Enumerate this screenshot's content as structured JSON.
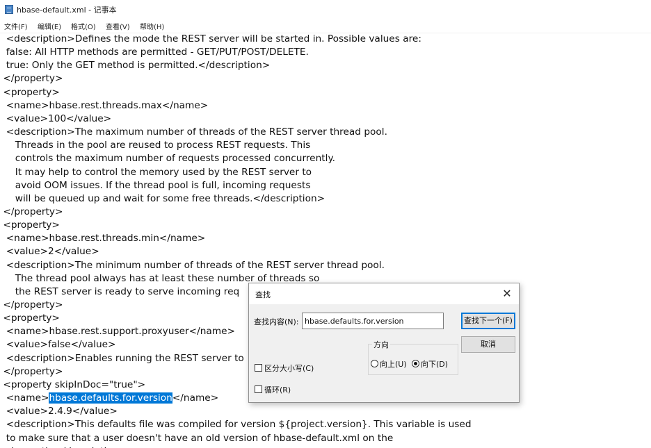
{
  "window": {
    "title": "hbase-default.xml - 记事本",
    "icon": "notepad-icon"
  },
  "menu": [
    {
      "label": "文件(F)"
    },
    {
      "label": "编辑(E)"
    },
    {
      "label": "格式(O)"
    },
    {
      "label": "查看(V)"
    },
    {
      "label": "帮助(H)"
    }
  ],
  "editor": {
    "lines": [
      "  <description>Defines the mode the REST server will be started in. Possible values are:",
      "  false: All HTTP methods are permitted - GET/PUT/POST/DELETE.",
      "  true: Only the GET method is permitted.</description>",
      " </property>",
      " <property>",
      "  <name>hbase.rest.threads.max</name>",
      "  <value>100</value>",
      "  <description>The maximum number of threads of the REST server thread pool.",
      "     Threads in the pool are reused to process REST requests. This",
      "     controls the maximum number of requests processed concurrently.",
      "     It may help to control the memory used by the REST server to",
      "     avoid OOM issues. If the thread pool is full, incoming requests",
      "     will be queued up and wait for some free threads.</description>",
      " </property>",
      " <property>",
      "  <name>hbase.rest.threads.min</name>",
      "  <value>2</value>",
      "  <description>The minimum number of threads of the REST server thread pool.",
      "     The thread pool always has at least these number of threads so",
      "     the REST server is ready to serve incoming req",
      " </property>",
      " <property>",
      "  <name>hbase.rest.support.proxyuser</name>",
      "  <value>false</value>",
      "  <description>Enables running the REST server to",
      " </property>",
      " <property skipInDoc=\"true\">",
      "  <name>",
      "  <value>2.4.9</value>",
      "  <description>This defaults file was compiled for version ${project.version}. This variable is used",
      "  to make sure that a user doesn't have an old version of hbase-default.xml on the",
      "  classpath.</description>"
    ],
    "selected_text": "hbase.defaults.for.version",
    "after_selection": "</name>"
  },
  "find_dialog": {
    "title": "查找",
    "find_label": "查找内容(N):",
    "find_value": "hbase.defaults.for.version",
    "find_next_button": "查找下一个(F)",
    "cancel_button": "取消",
    "direction_label": "方向",
    "direction_up": "向上(U)",
    "direction_down": "向下(D)",
    "direction_selected": "down",
    "match_case_label": "区分大小写(C)",
    "match_case_checked": false,
    "wrap_label": "循环(R)",
    "wrap_checked": false
  }
}
